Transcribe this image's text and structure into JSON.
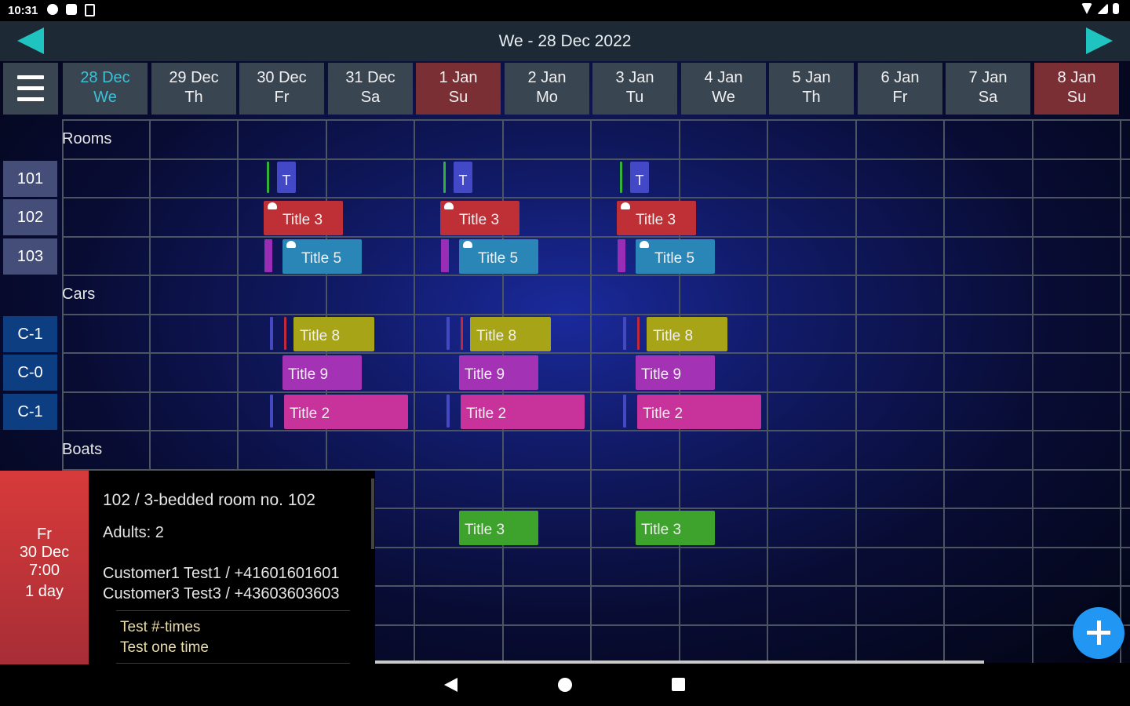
{
  "status": {
    "time": "10:31"
  },
  "header": {
    "title": "We - 28 Dec 2022"
  },
  "days": [
    {
      "date": "28 Dec",
      "dow": "We"
    },
    {
      "date": "29 Dec",
      "dow": "Th"
    },
    {
      "date": "30 Dec",
      "dow": "Fr"
    },
    {
      "date": "31 Dec",
      "dow": "Sa"
    },
    {
      "date": "1 Jan",
      "dow": "Su"
    },
    {
      "date": "2 Jan",
      "dow": "Mo"
    },
    {
      "date": "3 Jan",
      "dow": "Tu"
    },
    {
      "date": "4 Jan",
      "dow": "We"
    },
    {
      "date": "5 Jan",
      "dow": "Th"
    },
    {
      "date": "6 Jan",
      "dow": "Fr"
    },
    {
      "date": "7 Jan",
      "dow": "Sa"
    },
    {
      "date": "8 Jan",
      "dow": "Su"
    }
  ],
  "sections": {
    "rooms": "Rooms",
    "cars": "Cars",
    "boats": "Boats"
  },
  "rows": {
    "r101": "101",
    "r102": "102",
    "r103": "103",
    "c1": "C-1",
    "c0": "C-0",
    "c1b": "C-1"
  },
  "events": {
    "t": "T",
    "title3": "Title 3",
    "title5": "Title 5",
    "title8": "Title 8",
    "title9": "Title 9",
    "title2": "Title 2"
  },
  "detail": {
    "dow": "Fr",
    "date": "30 Dec",
    "time": "7:00",
    "duration": "1 day",
    "room": "102  /  3-bedded room no. 102",
    "adults": "Adults: 2",
    "customer1": "Customer1 Test1 / +41601601601",
    "customer2": "Customer3 Test3 / +43603603603",
    "note1": "Test #-times",
    "note2": "Test one time"
  },
  "colors": {
    "accent_teal": "#1fc4c0",
    "today_text": "#37c3d8",
    "weekend_header": "#7a2f35",
    "fab": "#2196f3"
  }
}
